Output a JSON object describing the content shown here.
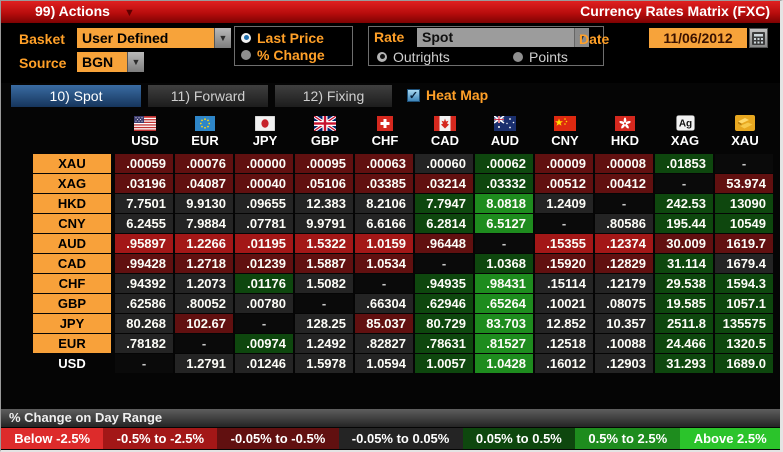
{
  "titlebar": {
    "actions_label": "99) Actions",
    "title": "Currency Rates Matrix (FXC)"
  },
  "controls": {
    "basket_label": "Basket",
    "basket_value": "User Defined",
    "source_label": "Source",
    "source_value": "BGN",
    "price_mode": {
      "options": [
        {
          "label": "Last Price",
          "selected": true
        },
        {
          "label": "% Change",
          "selected": false
        }
      ]
    },
    "rate_label": "Rate",
    "rate_value": "Spot",
    "rate_mode": {
      "options": [
        {
          "label": "Outrights",
          "selected": true
        },
        {
          "label": "Points",
          "selected": false
        }
      ]
    },
    "date_label": "Date",
    "date_value": "11/06/2012"
  },
  "tabs": [
    {
      "label": "10) Spot",
      "active": true
    },
    {
      "label": "11) Forward",
      "active": false
    },
    {
      "label": "12) Fixing",
      "active": false
    }
  ],
  "heatmap_toggle": {
    "label": "Heat Map",
    "checked": true
  },
  "heat_colors": {
    "r3": "#dd2b2b",
    "r2": "#a31717",
    "r1": "#611010",
    "n": "#242424",
    "g1": "#0e470e",
    "g2": "#1e8c1e",
    "g3": "#2bc42b",
    "d": "#0a0a0a"
  },
  "matrix": {
    "columns": [
      {
        "code": "USD",
        "flag": "us"
      },
      {
        "code": "EUR",
        "flag": "eu"
      },
      {
        "code": "JPY",
        "flag": "jp"
      },
      {
        "code": "GBP",
        "flag": "gb"
      },
      {
        "code": "CHF",
        "flag": "ch"
      },
      {
        "code": "CAD",
        "flag": "ca"
      },
      {
        "code": "AUD",
        "flag": "au"
      },
      {
        "code": "CNY",
        "flag": "cn"
      },
      {
        "code": "HKD",
        "flag": "hk"
      },
      {
        "code": "XAG",
        "flag": "silver"
      },
      {
        "code": "XAU",
        "flag": "gold"
      }
    ],
    "rows": [
      {
        "label": "XAU",
        "label_style": "orange",
        "cells": [
          {
            "v": ".00059",
            "c": "r1"
          },
          {
            "v": ".00076",
            "c": "r1"
          },
          {
            "v": ".00000",
            "c": "r1"
          },
          {
            "v": ".00095",
            "c": "r1"
          },
          {
            "v": ".00063",
            "c": "r1"
          },
          {
            "v": ".00060",
            "c": "n"
          },
          {
            "v": ".00062",
            "c": "g1"
          },
          {
            "v": ".00009",
            "c": "r1"
          },
          {
            "v": ".00008",
            "c": "r1"
          },
          {
            "v": ".01853",
            "c": "g1"
          },
          {
            "v": "-",
            "c": "d"
          }
        ]
      },
      {
        "label": "XAG",
        "label_style": "orange",
        "cells": [
          {
            "v": ".03196",
            "c": "r1"
          },
          {
            "v": ".04087",
            "c": "r1"
          },
          {
            "v": ".00040",
            "c": "r1"
          },
          {
            "v": ".05106",
            "c": "r1"
          },
          {
            "v": ".03385",
            "c": "r1"
          },
          {
            "v": ".03214",
            "c": "r1"
          },
          {
            "v": ".03332",
            "c": "g1"
          },
          {
            "v": ".00512",
            "c": "r1"
          },
          {
            "v": ".00412",
            "c": "r1"
          },
          {
            "v": "-",
            "c": "d"
          },
          {
            "v": "53.974",
            "c": "r1"
          }
        ]
      },
      {
        "label": "HKD",
        "label_style": "orange",
        "cells": [
          {
            "v": "7.7501",
            "c": "n"
          },
          {
            "v": "9.9130",
            "c": "n"
          },
          {
            "v": ".09655",
            "c": "n"
          },
          {
            "v": "12.383",
            "c": "n"
          },
          {
            "v": "8.2106",
            "c": "n"
          },
          {
            "v": "7.7947",
            "c": "g1"
          },
          {
            "v": "8.0818",
            "c": "g2"
          },
          {
            "v": "1.2409",
            "c": "n"
          },
          {
            "v": "-",
            "c": "d"
          },
          {
            "v": "242.53",
            "c": "g1"
          },
          {
            "v": "13090",
            "c": "g1"
          }
        ]
      },
      {
        "label": "CNY",
        "label_style": "orange",
        "cells": [
          {
            "v": "6.2455",
            "c": "n"
          },
          {
            "v": "7.9884",
            "c": "n"
          },
          {
            "v": ".07781",
            "c": "n"
          },
          {
            "v": "9.9791",
            "c": "n"
          },
          {
            "v": "6.6166",
            "c": "n"
          },
          {
            "v": "6.2814",
            "c": "g1"
          },
          {
            "v": "6.5127",
            "c": "g2"
          },
          {
            "v": "-",
            "c": "d"
          },
          {
            "v": ".80586",
            "c": "n"
          },
          {
            "v": "195.44",
            "c": "g1"
          },
          {
            "v": "10549",
            "c": "g1"
          }
        ]
      },
      {
        "label": "AUD",
        "label_style": "orange",
        "cells": [
          {
            "v": ".95897",
            "c": "r2"
          },
          {
            "v": "1.2266",
            "c": "r2"
          },
          {
            "v": ".01195",
            "c": "r2"
          },
          {
            "v": "1.5322",
            "c": "r2"
          },
          {
            "v": "1.0159",
            "c": "r2"
          },
          {
            "v": ".96448",
            "c": "r1"
          },
          {
            "v": "-",
            "c": "d"
          },
          {
            "v": ".15355",
            "c": "r2"
          },
          {
            "v": ".12374",
            "c": "r2"
          },
          {
            "v": "30.009",
            "c": "r1"
          },
          {
            "v": "1619.7",
            "c": "r1"
          }
        ]
      },
      {
        "label": "CAD",
        "label_style": "orange",
        "cells": [
          {
            "v": ".99428",
            "c": "r1"
          },
          {
            "v": "1.2718",
            "c": "r1"
          },
          {
            "v": ".01239",
            "c": "r1"
          },
          {
            "v": "1.5887",
            "c": "r1"
          },
          {
            "v": "1.0534",
            "c": "r1"
          },
          {
            "v": "-",
            "c": "d"
          },
          {
            "v": "1.0368",
            "c": "g1"
          },
          {
            "v": ".15920",
            "c": "r1"
          },
          {
            "v": ".12829",
            "c": "r1"
          },
          {
            "v": "31.114",
            "c": "g1"
          },
          {
            "v": "1679.4",
            "c": "n"
          }
        ]
      },
      {
        "label": "CHF",
        "label_style": "orange",
        "cells": [
          {
            "v": ".94392",
            "c": "n"
          },
          {
            "v": "1.2073",
            "c": "n"
          },
          {
            "v": ".01176",
            "c": "g1"
          },
          {
            "v": "1.5082",
            "c": "n"
          },
          {
            "v": "-",
            "c": "d"
          },
          {
            "v": ".94935",
            "c": "g1"
          },
          {
            "v": ".98431",
            "c": "g2"
          },
          {
            "v": ".15114",
            "c": "n"
          },
          {
            "v": ".12179",
            "c": "n"
          },
          {
            "v": "29.538",
            "c": "g1"
          },
          {
            "v": "1594.3",
            "c": "g1"
          }
        ]
      },
      {
        "label": "GBP",
        "label_style": "orange",
        "cells": [
          {
            "v": ".62586",
            "c": "n"
          },
          {
            "v": ".80052",
            "c": "n"
          },
          {
            "v": ".00780",
            "c": "n"
          },
          {
            "v": "-",
            "c": "d"
          },
          {
            "v": ".66304",
            "c": "n"
          },
          {
            "v": ".62946",
            "c": "g1"
          },
          {
            "v": ".65264",
            "c": "g2"
          },
          {
            "v": ".10021",
            "c": "n"
          },
          {
            "v": ".08075",
            "c": "n"
          },
          {
            "v": "19.585",
            "c": "g1"
          },
          {
            "v": "1057.1",
            "c": "g1"
          }
        ]
      },
      {
        "label": "JPY",
        "label_style": "orange",
        "cells": [
          {
            "v": "80.268",
            "c": "n"
          },
          {
            "v": "102.67",
            "c": "r1"
          },
          {
            "v": "-",
            "c": "d"
          },
          {
            "v": "128.25",
            "c": "n"
          },
          {
            "v": "85.037",
            "c": "r1"
          },
          {
            "v": "80.729",
            "c": "g1"
          },
          {
            "v": "83.703",
            "c": "g2"
          },
          {
            "v": "12.852",
            "c": "n"
          },
          {
            "v": "10.357",
            "c": "n"
          },
          {
            "v": "2511.8",
            "c": "g1"
          },
          {
            "v": "135575",
            "c": "g1"
          }
        ]
      },
      {
        "label": "EUR",
        "label_style": "orange",
        "cells": [
          {
            "v": ".78182",
            "c": "n"
          },
          {
            "v": "-",
            "c": "d"
          },
          {
            "v": ".00974",
            "c": "g1"
          },
          {
            "v": "1.2492",
            "c": "n"
          },
          {
            "v": ".82827",
            "c": "n"
          },
          {
            "v": ".78631",
            "c": "g1"
          },
          {
            "v": ".81527",
            "c": "g2"
          },
          {
            "v": ".12518",
            "c": "n"
          },
          {
            "v": ".10088",
            "c": "n"
          },
          {
            "v": "24.466",
            "c": "g1"
          },
          {
            "v": "1320.5",
            "c": "g1"
          }
        ]
      },
      {
        "label": "USD",
        "label_style": "plain",
        "cells": [
          {
            "v": "-",
            "c": "d"
          },
          {
            "v": "1.2791",
            "c": "n"
          },
          {
            "v": ".01246",
            "c": "n"
          },
          {
            "v": "1.5978",
            "c": "n"
          },
          {
            "v": "1.0594",
            "c": "n"
          },
          {
            "v": "1.0057",
            "c": "g1"
          },
          {
            "v": "1.0428",
            "c": "g2"
          },
          {
            "v": ".16012",
            "c": "n"
          },
          {
            "v": ".12903",
            "c": "n"
          },
          {
            "v": "31.293",
            "c": "g1"
          },
          {
            "v": "1689.0",
            "c": "g1"
          }
        ]
      }
    ]
  },
  "legend": {
    "title": "% Change on Day Range",
    "items": [
      {
        "label": "Below -2.5%",
        "c": "r3"
      },
      {
        "label": "-0.5% to -2.5%",
        "c": "r2"
      },
      {
        "label": "-0.05% to -0.5%",
        "c": "r1"
      },
      {
        "label": "-0.05% to 0.05%",
        "c": "n"
      },
      {
        "label": "0.05% to 0.5%",
        "c": "g1"
      },
      {
        "label": "0.5% to 2.5%",
        "c": "g2"
      },
      {
        "label": "Above 2.5%",
        "c": "g3"
      }
    ]
  }
}
